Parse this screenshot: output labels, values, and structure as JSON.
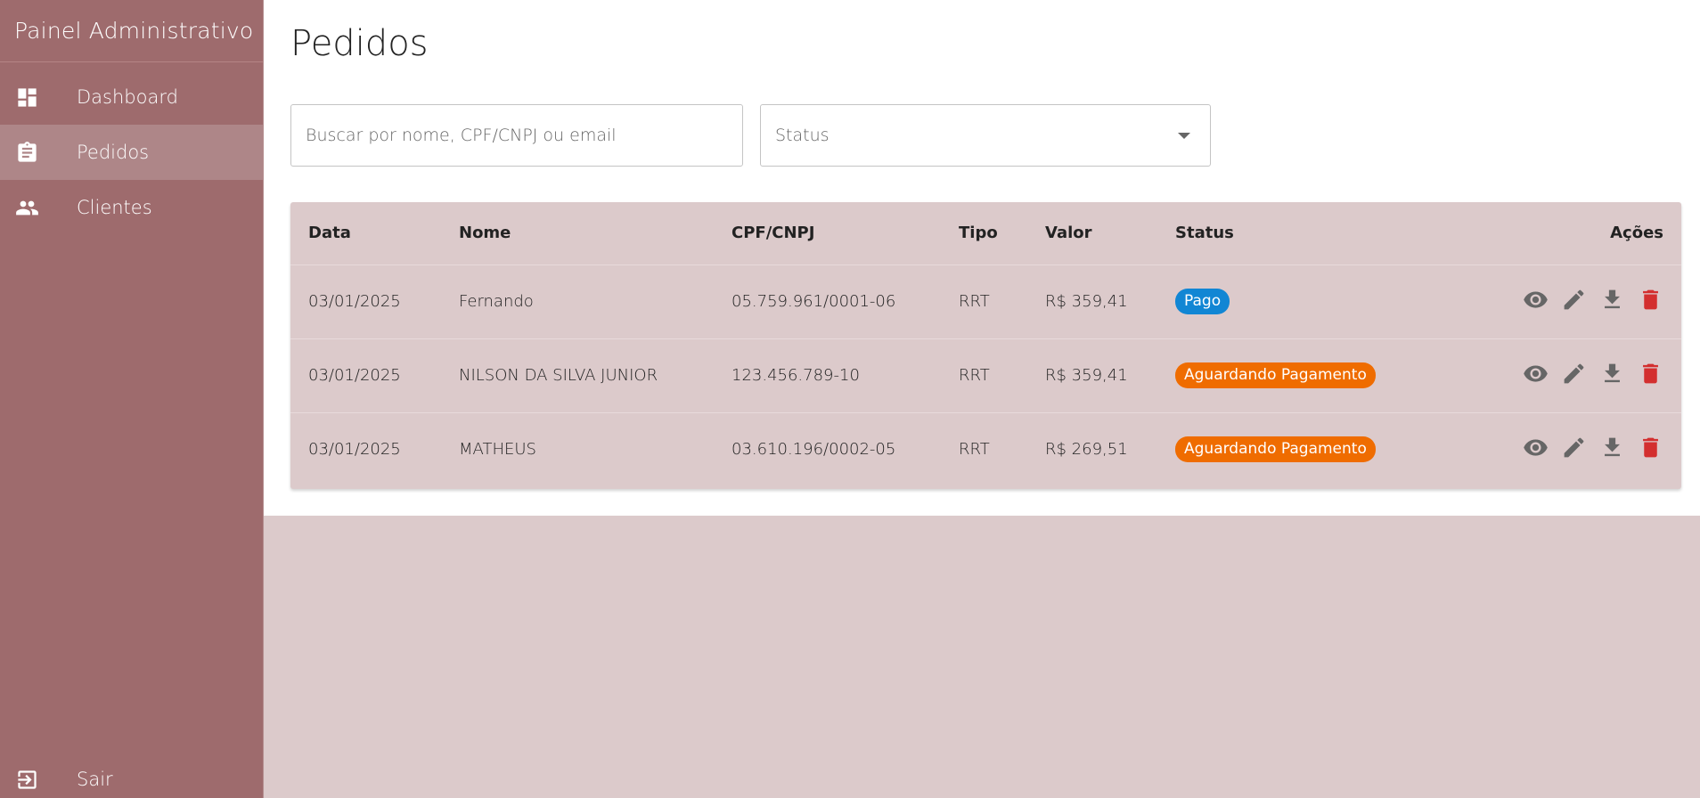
{
  "app": {
    "title": "Painel Administrativo"
  },
  "sidebar": {
    "items": [
      {
        "label": "Dashboard",
        "icon": "dashboard-icon"
      },
      {
        "label": "Pedidos",
        "icon": "clipboard-icon",
        "active": true
      },
      {
        "label": "Clientes",
        "icon": "people-icon"
      }
    ],
    "logout": {
      "label": "Sair",
      "icon": "logout-icon"
    }
  },
  "page": {
    "title": "Pedidos"
  },
  "filters": {
    "search_placeholder": "Buscar por nome, CPF/CNPJ ou email",
    "search_value": "",
    "status_label": "Status"
  },
  "table": {
    "headers": {
      "date": "Data",
      "name": "Nome",
      "doc": "CPF/CNPJ",
      "type": "Tipo",
      "value": "Valor",
      "status": "Status",
      "actions": "Ações"
    },
    "rows": [
      {
        "date": "03/01/2025",
        "name": "Fernando",
        "doc": "05.759.961/0001-06",
        "type": "RRT",
        "value": "R$ 359,41",
        "status": "Pago"
      },
      {
        "date": "03/01/2025",
        "name": "NILSON DA SILVA JUNIOR",
        "doc": "123.456.789-10",
        "type": "RRT",
        "value": "R$ 359,41",
        "status": "Aguardando Pagamento"
      },
      {
        "date": "03/01/2025",
        "name": "MATHEUS",
        "doc": "03.610.196/0002-05",
        "type": "RRT",
        "value": "R$ 269,51",
        "status": "Aguardando Pagamento"
      }
    ]
  },
  "colors": {
    "sidebar_bg": "#9e6b6d",
    "sidebar_active": "#ae8688",
    "content_bg": "#dccacb",
    "status_paid": "#1186d4",
    "status_pending": "#ef6c00",
    "delete_icon": "#d32f2f"
  }
}
